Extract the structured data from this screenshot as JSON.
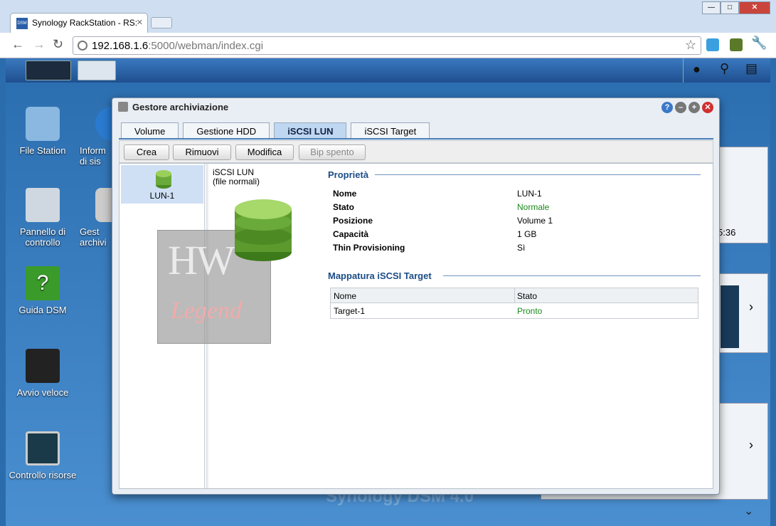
{
  "browser": {
    "tab_title": "Synology RackStation - RS:",
    "favicon": "DSM",
    "url_host": "192.168.1.6",
    "url_rest": ":5000/webman/index.cgi"
  },
  "desktop": {
    "icons": [
      {
        "label": "File Station"
      },
      {
        "label": "Inform di sis"
      },
      {
        "label": "Pannello di controllo"
      },
      {
        "label": "Gest archivi"
      },
      {
        "label": "Guida DSM"
      },
      {
        "label": "Avvio veloce"
      },
      {
        "label": "Controllo risorse"
      }
    ],
    "clock": "5:36",
    "brand": "Synology DSM 4.0"
  },
  "window": {
    "title": "Gestore archiviazione",
    "tabs": [
      "Volume",
      "Gestione HDD",
      "iSCSI LUN",
      "iSCSI Target"
    ],
    "buttons": [
      "Crea",
      "Rimuovi",
      "Modifica",
      "Bip spento"
    ],
    "lun_item": "LUN-1",
    "lun_type": "iSCSI LUN",
    "lun_subtype": "(file normali)",
    "props_title": "Proprietà",
    "props": [
      {
        "k": "Nome",
        "v": "LUN-1"
      },
      {
        "k": "Stato",
        "v": "Normale"
      },
      {
        "k": "Posizione",
        "v": "Volume 1"
      },
      {
        "k": "Capacità",
        "v": "1 GB"
      },
      {
        "k": "Thin Provisioning",
        "v": "Sì"
      }
    ],
    "mapping_title": "Mappatura iSCSI Target",
    "grid_headers": [
      "Nome",
      "Stato"
    ],
    "grid_rows": [
      {
        "nome": "Target-1",
        "stato": "Pronto"
      }
    ]
  },
  "watermark": {
    "top": "HW",
    "bottom": "Legend"
  },
  "colors": {
    "status_green": "#1b8a1b",
    "section_blue": "#1b4c87"
  }
}
